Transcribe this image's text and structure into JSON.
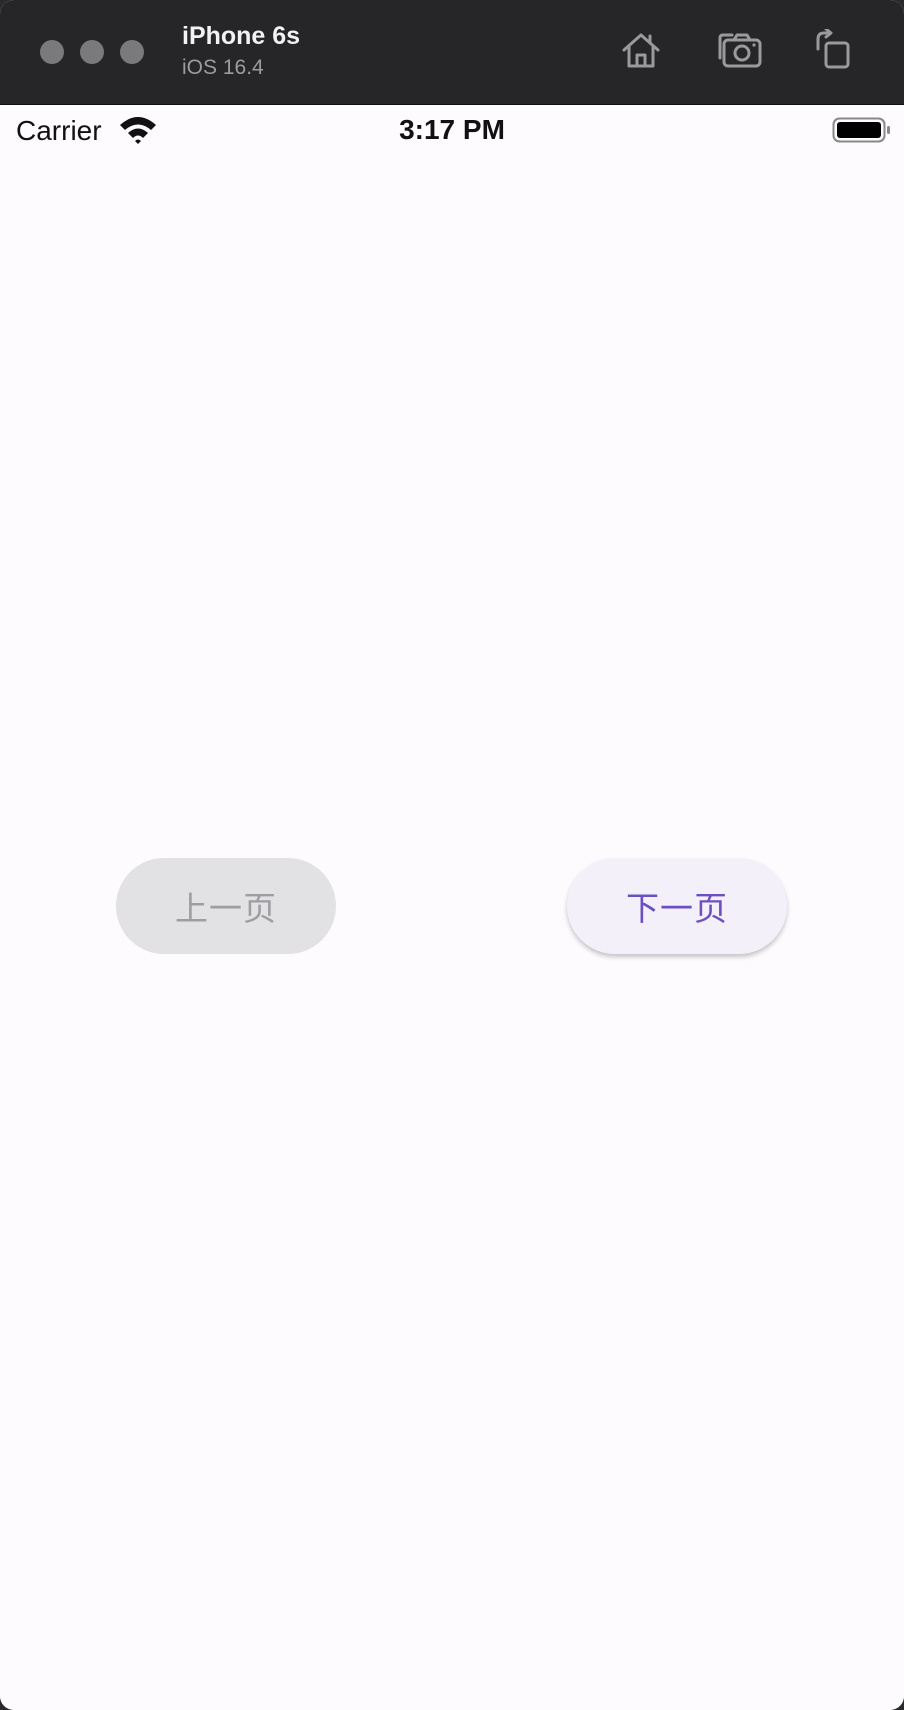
{
  "simulator": {
    "device_name": "iPhone 6s",
    "os_version": "iOS 16.4",
    "toolbar_icons": [
      "home-icon",
      "camera-icon",
      "rotate-icon"
    ]
  },
  "status_bar": {
    "carrier": "Carrier",
    "time": "3:17 PM",
    "icons": [
      "wifi-icon",
      "battery-icon"
    ]
  },
  "app": {
    "prev_button_label": "上一页",
    "prev_button_enabled": false,
    "next_button_label": "下一页",
    "next_button_enabled": true
  },
  "colors": {
    "accent": "#6c4fc1",
    "background": "#fdfbfe",
    "disabled_bg": "#e2e1e4",
    "disabled_text": "#9e9ea2"
  }
}
